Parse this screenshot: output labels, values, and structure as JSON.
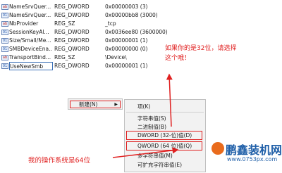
{
  "registry": {
    "rows": [
      {
        "icon": "ab",
        "name": "NameSrvQuer...",
        "type": "REG_DWORD",
        "data": "0x00000003 (3)"
      },
      {
        "icon": "bin",
        "name": "NameSrvQuer...",
        "type": "REG_DWORD",
        "data": "0x00000bb8 (3000)"
      },
      {
        "icon": "ab",
        "name": "NbProvider",
        "type": "REG_SZ",
        "data": "_tcp"
      },
      {
        "icon": "bin",
        "name": "SessionKeyAl...",
        "type": "REG_DWORD",
        "data": "0x0036ee80 (3600000)"
      },
      {
        "icon": "bin",
        "name": "Size/Small/Me...",
        "type": "REG_DWORD",
        "data": "0x00000001 (1)"
      },
      {
        "icon": "bin",
        "name": "SMBDeviceEna...",
        "type": "REG_QWORD",
        "data": "0x00000000 (0)"
      },
      {
        "icon": "ab",
        "name": "TransportBind...",
        "type": "REG_SZ",
        "data": "\\Device\\"
      },
      {
        "icon": "bin",
        "name": "UseNewSmb",
        "type": "REG_DWORD",
        "data": "0x00000001 (1)"
      }
    ]
  },
  "annotations": {
    "top": "如果你的是32位，请选择这个哦！",
    "bottom": "我的操作系统是64位"
  },
  "context_menu": {
    "new_label": "新建(N)",
    "new_arrow": "▶"
  },
  "submenu": {
    "items": [
      "项(K)",
      "字符串值(S)",
      "二进制值(B)",
      "DWORD (32-位)值(D)",
      "QWORD (64 位)值(Q)",
      "多字符串值(M)",
      "可扩充字符串值(E)"
    ]
  },
  "watermark": {
    "name": "鹏鑫装机网",
    "url": "www.0753px.com"
  },
  "colors": {
    "annotation": "#e02020",
    "brand": "#1f5fa8"
  }
}
